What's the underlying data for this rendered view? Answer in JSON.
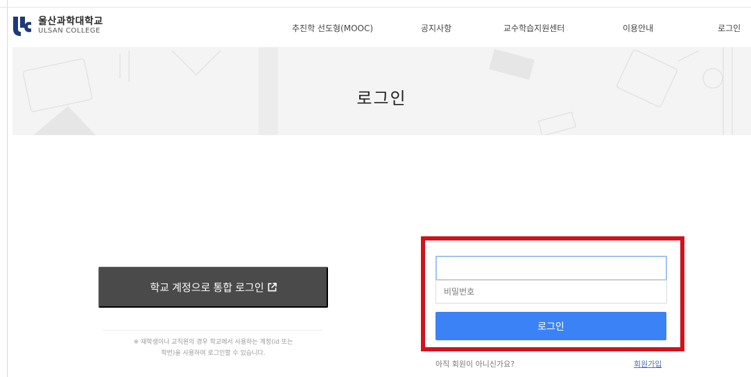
{
  "header": {
    "logo_kr": "울산과학대학교",
    "logo_en": "ULSAN COLLEGE",
    "nav": [
      "추진학 선도형(MOOC)",
      "공지사항",
      "교수학습지원센터",
      "이용안내",
      "로그인"
    ]
  },
  "hero": {
    "title": "로그인"
  },
  "sso": {
    "button_label": "학교 계정으로 통합 로그인",
    "notice_line1": "※ 재학생이나 교직원의 경우 학교에서 사용하는 계정(id 또는",
    "notice_line2": "학번)을 사용하여 로그인할 수 있습니다."
  },
  "form": {
    "id_value": "",
    "password_placeholder": "비밀번호",
    "login_label": "로그인",
    "signup_question": "아직 회원이 아니신가요?",
    "signup_link": "회원가입"
  },
  "colors": {
    "login_button": "#3b82f6",
    "sso_button": "#4a4a4a",
    "highlight_border": "#d0121b",
    "logo": "#1d3a7a"
  }
}
